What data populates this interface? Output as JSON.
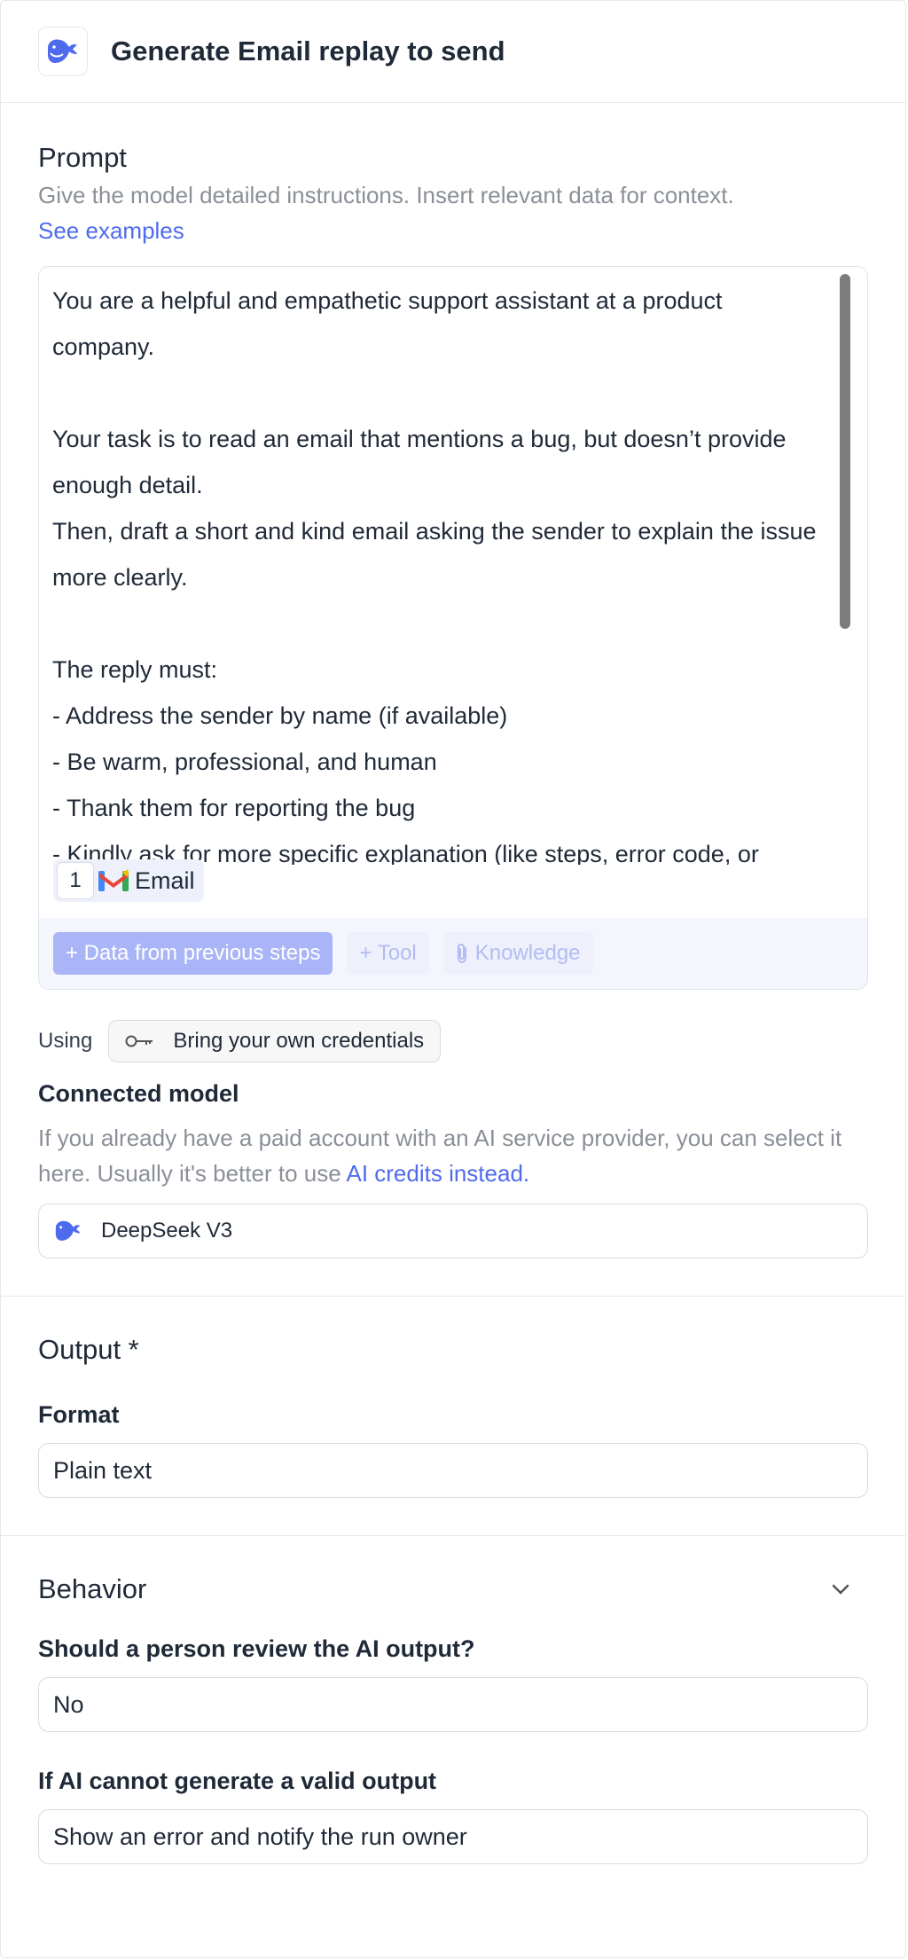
{
  "header": {
    "title": "Generate Email replay to send",
    "icon": "deepseek-whale-icon"
  },
  "prompt": {
    "title": "Prompt",
    "description": "Give the model detailed instructions. Insert relevant data for context.",
    "examples_link": "See examples",
    "text": "You are a helpful and empathetic support assistant at a product company.\n\nYour task is to read an email that mentions a bug, but doesn’t provide enough detail.\nThen, draft a short and kind email asking the sender to explain the issue more clearly.\n\nThe reply must:\n- Address the sender by name (if available)\n- Be warm, professional, and human\n- Thank them for reporting the bug\n- Kindly ask for more specific explanation (like steps, error code, or",
    "chip": {
      "number": "1",
      "label": "Email",
      "icon": "gmail-icon"
    },
    "toolbar": {
      "data_button": "+ Data from previous steps",
      "tool_button": "+ Tool",
      "knowledge_button": "Knowledge"
    }
  },
  "credentials": {
    "using_label": "Using",
    "chip_label": "Bring your own credentials",
    "icon": "key-icon"
  },
  "connected_model": {
    "label": "Connected model",
    "description": "If you already have a paid account with an AI service provider, you can select it here. Usually it's better to use ",
    "link": "AI credits instead.",
    "value": "DeepSeek V3"
  },
  "output": {
    "title": "Output *",
    "format_label": "Format",
    "format_value": "Plain text"
  },
  "behavior": {
    "title": "Behavior",
    "review_label": "Should a person review the AI output?",
    "review_value": "No",
    "fallback_label": "If AI cannot generate a valid output",
    "fallback_value": "Show an error and notify the run owner"
  },
  "colors": {
    "accent": "#4f6bed",
    "muted": "#8a8f98",
    "border": "#dfe3ea"
  }
}
